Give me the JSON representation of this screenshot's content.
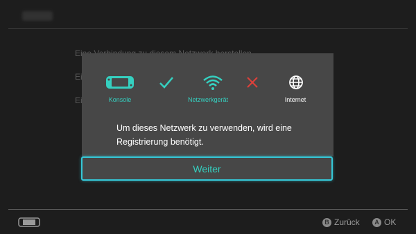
{
  "background": {
    "options": [
      "Eine Verbindung zu diesem Netzwerk herstellen",
      "Ei",
      "Ei"
    ]
  },
  "status": {
    "console": {
      "label": "Konsole",
      "icon": "console-icon",
      "color": "#35d0c0"
    },
    "link1": {
      "icon": "checkmark-icon",
      "color": "#35d0c0"
    },
    "device": {
      "label": "Netzwerkgerät",
      "icon": "wifi-icon",
      "color": "#35d0c0"
    },
    "link2": {
      "icon": "cross-icon",
      "color": "#e0403a"
    },
    "internet": {
      "label": "Internet",
      "icon": "globe-icon",
      "color": "#ffffff"
    }
  },
  "dialog": {
    "message_line1": "Um dieses Netzwerk zu verwenden, wird eine",
    "message_line2": "Registrierung benötigt.",
    "button_label": "Weiter",
    "accent": "#35c8d8"
  },
  "footer": {
    "back_key": "B",
    "back_label": "Zurück",
    "ok_key": "A",
    "ok_label": "OK"
  }
}
